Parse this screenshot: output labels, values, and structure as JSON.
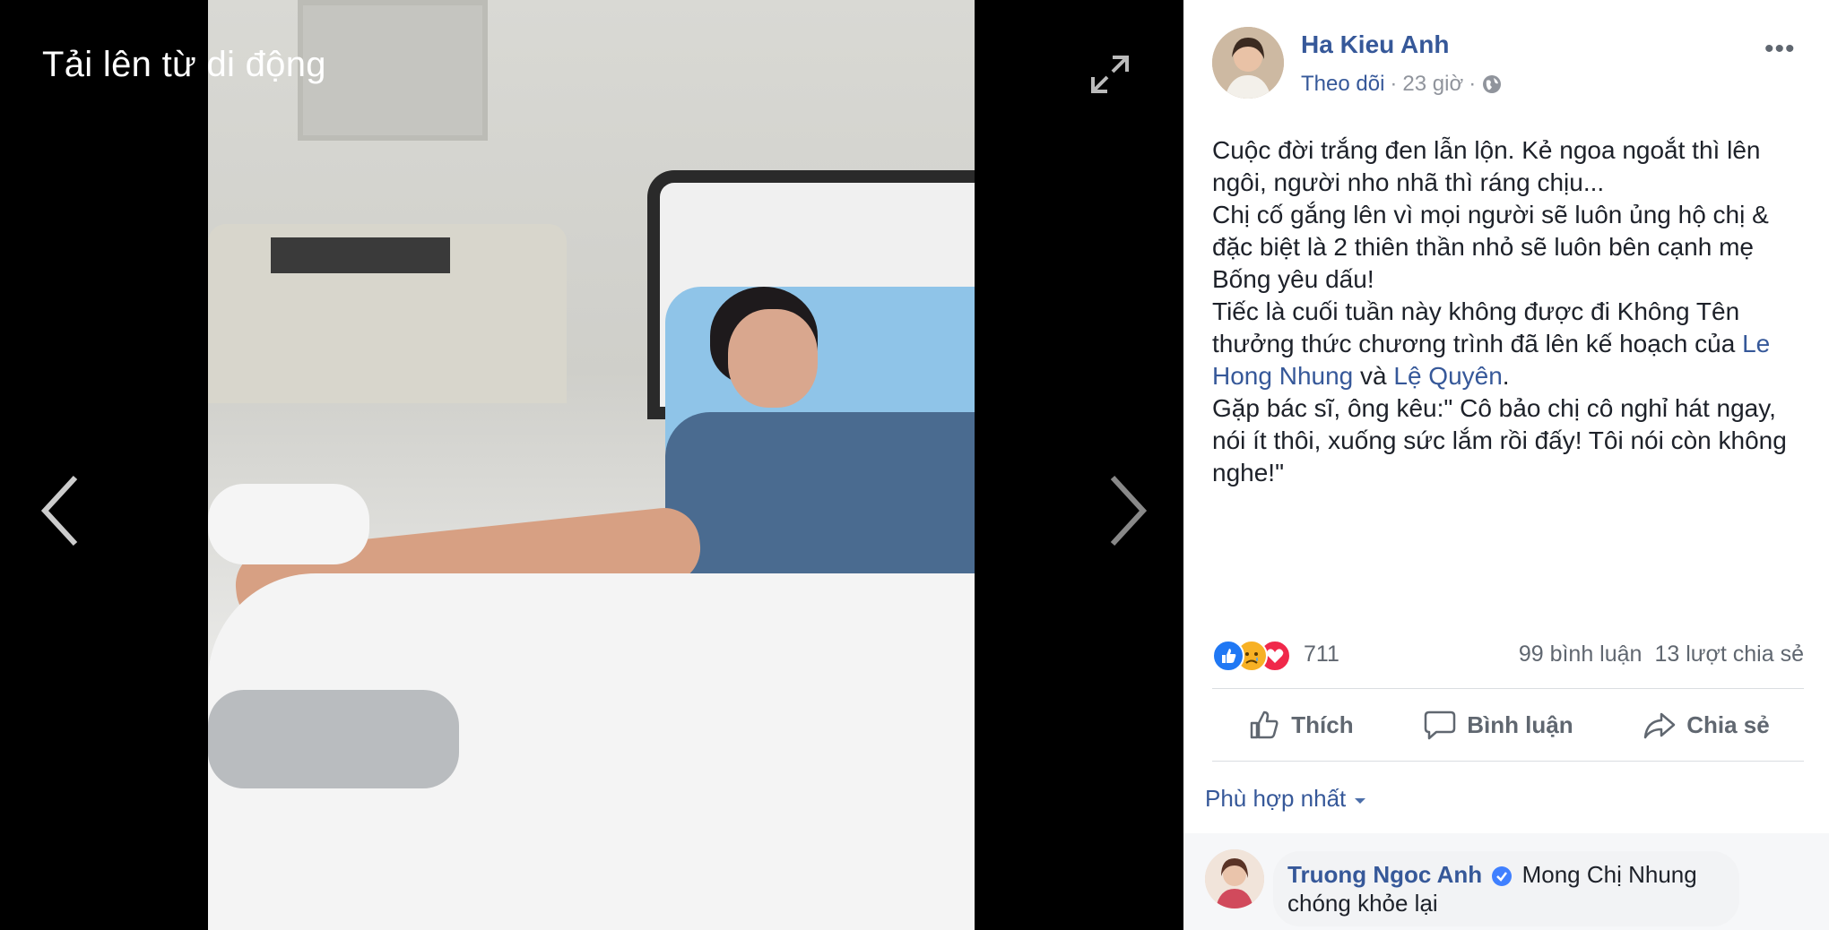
{
  "viewer": {
    "upload_label": "Tải lên từ di động"
  },
  "post": {
    "author": "Ha Kieu Anh",
    "follow_label": "Theo dõi",
    "time": "23 giờ",
    "text_part1": "Cuộc đời trắng đen lẫn lộn. Kẻ ngoa ngoắt thì lên ngôi, người nho nhã thì ráng chịu...",
    "text_part2": "Chị cố gắng lên vì mọi người sẽ luôn ủng hộ chị & đặc biệt là 2 thiên thần nhỏ sẽ luôn bên cạnh mẹ Bống yêu dấu!",
    "text_part3_prefix": "Tiếc là cuối tuần này không được đi Không Tên thưởng thức chương trình đã lên kế hoạch của",
    "mention1": "Le Hong Nhung",
    "text_connector": "và",
    "mention2": "Lệ Quyên",
    "text_part3_suffix": ".",
    "text_part4": "Gặp bác sĩ, ông kêu:\" Cô bảo chị cô nghỉ hát ngay, nói ít thôi, xuống sức lắm rồi đấy! Tôi nói còn không nghe!\""
  },
  "reactions": {
    "count": "711",
    "comments": "99 bình luận",
    "shares": "13 lượt chia sẻ"
  },
  "actions": {
    "like": "Thích",
    "comment": "Bình luận",
    "share": "Chia sẻ"
  },
  "comments_section": {
    "sort_label": "Phù hợp nhất",
    "first_comment": {
      "author": "Truong Ngoc Anh",
      "text": "Mong Chị Nhung chóng khỏe lại"
    }
  },
  "colors": {
    "link": "#365899",
    "like": "#2078f4",
    "love": "#f0284a",
    "sad": "#f7b125"
  }
}
